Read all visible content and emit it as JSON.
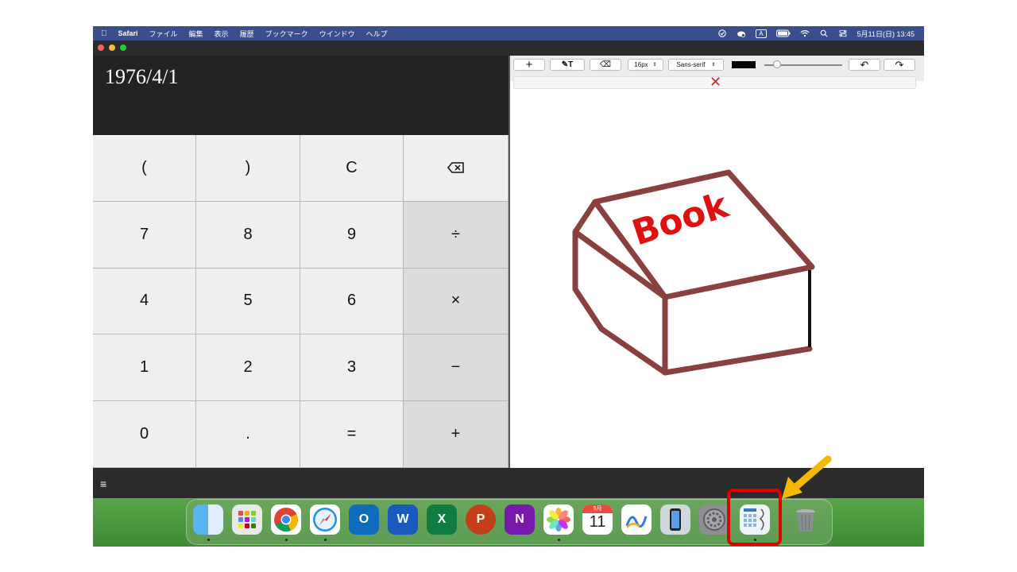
{
  "menubar": {
    "items": [
      "Safari",
      "ファイル",
      "編集",
      "表示",
      "履歴",
      "ブックマーク",
      "ウインドウ",
      "ヘルプ"
    ],
    "clock": "5月11日(日) 13:45",
    "status_icons": [
      "focus-icon",
      "weather-icon",
      "input-A-icon",
      "battery-icon",
      "wifi-icon",
      "search-icon",
      "control-center-icon"
    ],
    "input_label": "A"
  },
  "calculator": {
    "display": "1976/4/1",
    "keys": [
      [
        "(",
        ")",
        "C",
        "⌫"
      ],
      [
        "7",
        "8",
        "9",
        "÷"
      ],
      [
        "4",
        "5",
        "6",
        "×"
      ],
      [
        "1",
        "2",
        "3",
        "−"
      ],
      [
        "0",
        ".",
        "=",
        "+"
      ]
    ]
  },
  "draw_toolbar": {
    "add_label": "+",
    "text_tool_label": "✎T",
    "eraser_label": "⌫",
    "font_size": "16px",
    "font_family": "Sans-serif",
    "color": "#000000",
    "undo_label": "↶",
    "redo_label": "↷",
    "clear_symbol": "✕"
  },
  "drawing": {
    "text": "Book",
    "stroke_color": "#8b4040",
    "text_color": "#e01010",
    "edge_color": "#111111"
  },
  "status_bar": {
    "menu_symbol": "≡"
  },
  "dock": {
    "apps": [
      "Finder",
      "Launchpad",
      "Chrome",
      "Safari",
      "Outlook",
      "Word",
      "Excel",
      "PowerPoint",
      "OneNote",
      "Photos",
      "Calendar",
      "Freeform",
      "iPhone Mirroring",
      "System Settings",
      "Calculator",
      "Trash"
    ],
    "calendar_month": "5月",
    "calendar_day": "11"
  },
  "annotation": {
    "highlight_color": "#e00000",
    "arrow_color": "#f5b800"
  }
}
